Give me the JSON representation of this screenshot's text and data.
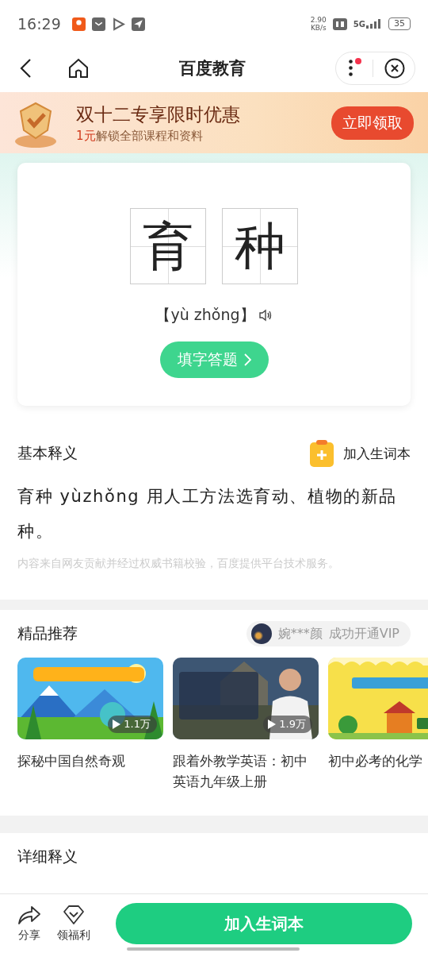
{
  "status_bar": {
    "time": "16:29",
    "speed": "2.90",
    "speed_unit": "KB/s",
    "network": "5G",
    "battery": "35"
  },
  "nav": {
    "title": "百度教育",
    "notification": true
  },
  "banner": {
    "title": "双十二专享限时优惠",
    "price": "1元",
    "subtitle": "解锁全部课程和资料",
    "button": "立即领取"
  },
  "word": {
    "characters": [
      "育",
      "种"
    ],
    "pinyin": "【yù zhǒng】",
    "quiz_button": "填字答题"
  },
  "basic": {
    "title": "基本释义",
    "add_label": "加入生词本",
    "definition": "育种 yùzhǒng 用人工方法选育动、植物的新品种。",
    "source": "内容来自网友贡献并经过权威书籍校验，百度提供平台技术服务。"
  },
  "recommend": {
    "title": "精品推荐",
    "vip_user": "婉***颜",
    "vip_text": "成功开通VIP",
    "courses": [
      {
        "kind": "picture",
        "title": "探秘中国自然奇观",
        "plays": "1.1万"
      },
      {
        "kind": "picture",
        "title": "跟着外教学英语：初中英语九年级上册",
        "plays": "1.9万"
      },
      {
        "kind": "picture",
        "title": "初中必考的化学"
      }
    ]
  },
  "detail": {
    "title": "详细释义"
  },
  "bottom_bar": {
    "share": "分享",
    "benefits": "领福利",
    "button": "加入生词本"
  }
}
